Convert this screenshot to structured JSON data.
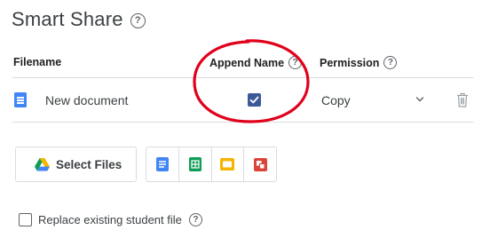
{
  "header": {
    "title": "Smart Share",
    "help_glyph": "?"
  },
  "table": {
    "columns": {
      "filename": "Filename",
      "append_name": "Append Name",
      "permission": "Permission"
    },
    "rows": [
      {
        "icon": "google-docs-icon",
        "filename": "New document",
        "append_name_checked": true,
        "permission": "Copy"
      }
    ]
  },
  "actions": {
    "select_files_label": "Select Files",
    "create_icons": [
      "google-docs-icon",
      "google-sheets-icon",
      "google-slides-icon",
      "google-drawings-icon"
    ]
  },
  "options": {
    "replace_label": "Replace existing student file",
    "replace_checked": false
  },
  "colors": {
    "annotation": "#e0001b",
    "checkbox_checked": "#3c5a99",
    "docs": "#4285f4",
    "sheets": "#0f9d58",
    "slides": "#f4b400",
    "drawings": "#db4437"
  }
}
